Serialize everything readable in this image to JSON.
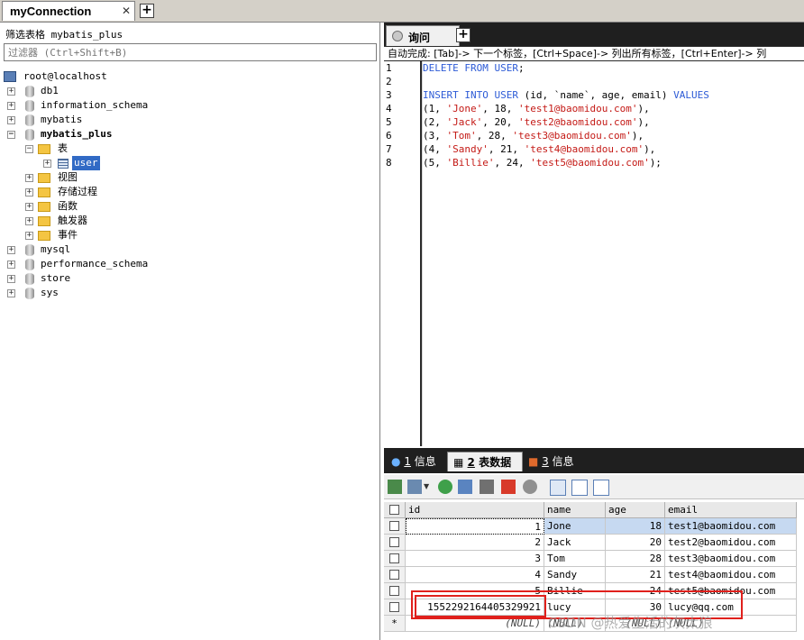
{
  "connection_tab": {
    "label": "myConnection",
    "close": "✕",
    "add": "+"
  },
  "browser": {
    "db_label": "筛选表格 mybatis_plus",
    "filter_placeholder": "过滤器 (Ctrl+Shift+B)",
    "server": "root@localhost",
    "databases": [
      "db1",
      "information_schema",
      "mybatis",
      "mybatis_plus",
      "mysql",
      "performance_schema",
      "store",
      "sys"
    ],
    "mybatis_plus_children": {
      "tables_folder": "表",
      "table_user": "user",
      "views": "视图",
      "procs": "存储过程",
      "functions": "函数",
      "triggers": "触发器",
      "events": "事件"
    }
  },
  "query": {
    "tab_label": "询问",
    "add": "+",
    "hint": "自动完成: [Tab]-> 下一个标签，[Ctrl+Space]-> 列出所有标签，[Ctrl+Enter]-> 列",
    "line_numbers": [
      "1",
      "2",
      "3",
      "4",
      "5",
      "6",
      "7",
      "8"
    ],
    "line1_kw": "DELETE FROM USER",
    "line1_end": ";",
    "line3_kw1": "INSERT INTO USER",
    "line3_mid": " (id, `name`, age, email) ",
    "line3_kw2": "VALUES",
    "rows": [
      {
        "id": "1",
        "name": "'Jone'",
        "age": "18",
        "email": "'test1@baomidou.com'",
        "end": "),"
      },
      {
        "id": "2",
        "name": "'Jack'",
        "age": "20",
        "email": "'test2@baomidou.com'",
        "end": "),"
      },
      {
        "id": "3",
        "name": "'Tom'",
        "age": "28",
        "email": "'test3@baomidou.com'",
        "end": "),"
      },
      {
        "id": "4",
        "name": "'Sandy'",
        "age": "21",
        "email": "'test4@baomidou.com'",
        "end": "),"
      },
      {
        "id": "5",
        "name": "'Billie'",
        "age": "24",
        "email": "'test5@baomidou.com'",
        "end": ");"
      }
    ]
  },
  "results": {
    "tabs": [
      {
        "num": "1",
        "label": "信息"
      },
      {
        "num": "2",
        "label": "表数据"
      },
      {
        "num": "3",
        "label": "信息"
      }
    ],
    "columns": [
      "id",
      "name",
      "age",
      "email"
    ],
    "rows": [
      {
        "id": "1",
        "name": "Jone",
        "age": "18",
        "email": "test1@baomidou.com"
      },
      {
        "id": "2",
        "name": "Jack",
        "age": "20",
        "email": "test2@baomidou.com"
      },
      {
        "id": "3",
        "name": "Tom",
        "age": "28",
        "email": "test3@baomidou.com"
      },
      {
        "id": "4",
        "name": "Sandy",
        "age": "21",
        "email": "test4@baomidou.com"
      },
      {
        "id": "5",
        "name": "Billie",
        "age": "24",
        "email": "test5@baomidou.com"
      },
      {
        "id": "1552292164405329921",
        "name": "lucy",
        "age": "30",
        "email": "lucy@qq.com"
      }
    ],
    "new_row": {
      "marker": "*",
      "id": "(NULL)",
      "name": "(NULL)",
      "age": "(NULL)",
      "email": "(NULL)"
    }
  },
  "watermark": "CSDN @热爱生活的灰太狼",
  "colors": {
    "highlight": "#e0201c",
    "selection": "#316ac5",
    "keyword": "#2d5bd6",
    "string": "#c41a16"
  }
}
